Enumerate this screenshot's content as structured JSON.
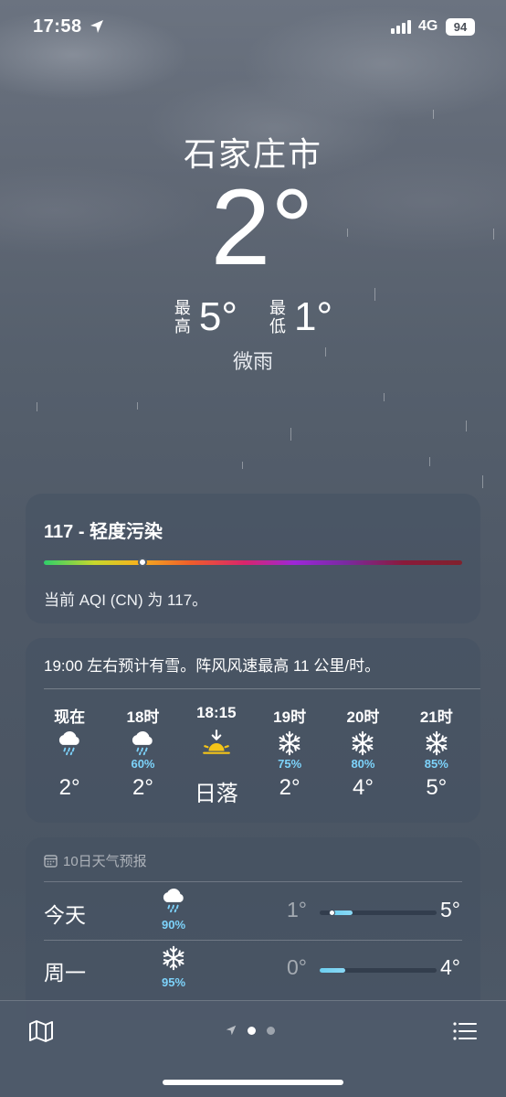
{
  "status_bar": {
    "time": "17:58",
    "network": "4G",
    "battery": "94"
  },
  "header": {
    "city": "石家庄市",
    "temperature": "2°",
    "high_label": "最高",
    "high": "5°",
    "low_label": "最低",
    "low": "1°",
    "condition": "微雨"
  },
  "aqi": {
    "title": "117 - 轻度污染",
    "indicator_fraction": 0.235,
    "description": "当前 AQI (CN) 为 117。"
  },
  "hourly": {
    "summary": "19:00 左右预计有雪。阵风风速最高 11 公里/时。",
    "items": [
      {
        "label": "现在",
        "icon": "cloud-rain-icon",
        "pop": "",
        "temp": "2°"
      },
      {
        "label": "18时",
        "icon": "cloud-rain-icon",
        "pop": "60%",
        "temp": "2°"
      },
      {
        "label": "18:15",
        "icon": "sunset-icon",
        "pop": "",
        "temp": "日落"
      },
      {
        "label": "19时",
        "icon": "snowflake-icon",
        "pop": "75%",
        "temp": "2°"
      },
      {
        "label": "20时",
        "icon": "snowflake-icon",
        "pop": "80%",
        "temp": "4°"
      },
      {
        "label": "21时",
        "icon": "snowflake-icon",
        "pop": "85%",
        "temp": "5°"
      }
    ]
  },
  "daily": {
    "title": "10日天气预报",
    "days": [
      {
        "name": "今天",
        "icon": "cloud-rain-icon",
        "pop": "90%",
        "low": "1°",
        "high": "5°",
        "range_start": 0.1,
        "range_end": 0.28,
        "current": 0.1
      },
      {
        "name": "周一",
        "icon": "snowflake-icon",
        "pop": "95%",
        "low": "0°",
        "high": "4°",
        "range_start": 0.0,
        "range_end": 0.22
      }
    ]
  },
  "colors": {
    "background": "#56606d",
    "precip": "#7dd3fb",
    "sun": "#f5c518"
  }
}
